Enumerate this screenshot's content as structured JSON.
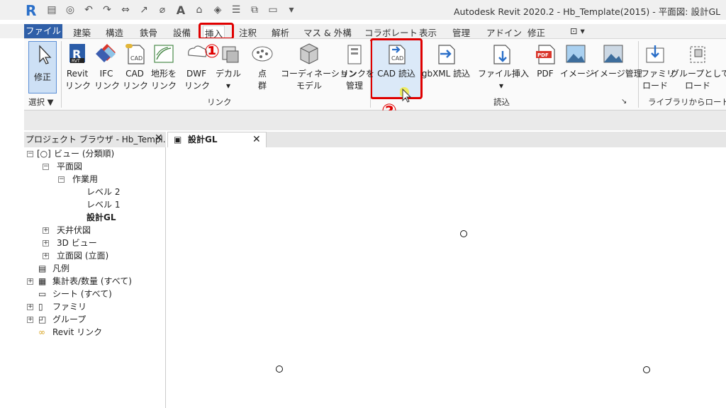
{
  "window": {
    "title": "Autodesk Revit 2020.2 - Hb_Template(2015) - 平面図: 設計GL",
    "logo": "R"
  },
  "ribbon_tabs": [
    "ファイル",
    "建築",
    "構造",
    "鉄骨",
    "設備",
    "挿入",
    "注釈",
    "解析",
    "マス & 外構",
    "コラボレート",
    "表示",
    "管理",
    "アドイン",
    "修正"
  ],
  "active_tab": "挿入",
  "ribbon": {
    "modify": {
      "line1": "修正"
    },
    "select_panel": "選択 ▼",
    "link_panel": "リンク",
    "import_panel": "読込",
    "library_panel": "ライブラリからロード",
    "buttons": {
      "revit_link": [
        "Revit",
        "リンク"
      ],
      "ifc_link": [
        "IFC",
        "リンク"
      ],
      "cad_link": [
        "CAD",
        "リンク"
      ],
      "topo_link": [
        "地形を",
        "リンク"
      ],
      "dwf_link": [
        "DWF",
        "リンク"
      ],
      "decal": [
        "デカル",
        ""
      ],
      "point_cloud": [
        "点",
        "群"
      ],
      "coordination_model": [
        "コーディネーション",
        "モデル"
      ],
      "manage_links": [
        "リンクを",
        "管理"
      ],
      "cad_import": [
        "CAD 読込",
        ""
      ],
      "gbxml_import": [
        "gbXML 読込",
        ""
      ],
      "file_insert": [
        "ファイル挿入",
        ""
      ],
      "pdf": [
        "PDF",
        ""
      ],
      "image": [
        "イメージ",
        ""
      ],
      "image_manage": [
        "イメージ管理",
        ""
      ],
      "family_load": [
        "ファミリ",
        "ロード"
      ],
      "group_load": [
        "グループとして",
        "ロード"
      ]
    },
    "step1": "①",
    "step2": "②"
  },
  "browser": {
    "header": "プロジェクト ブラウザ - Hb_Templ...",
    "items": {
      "views": "ビュー (分類順)",
      "floor_plans": "平面図",
      "working": "作業用",
      "level2": "レベル 2",
      "level1": "レベル 1",
      "design_gl": "設計GL",
      "ceiling": "天井伏図",
      "view3d": "3D ビュー",
      "elevations": "立面図 (立面)",
      "legends": "凡例",
      "schedules": "集計表/数量 (すべて)",
      "sheets": "シート (すべて)",
      "families": "ファミリ",
      "groups": "グループ",
      "revit_links": "Revit リンク"
    }
  },
  "view_tab": {
    "label": "設計GL"
  },
  "colors": {
    "accent": "#2f5fa8",
    "highlight": "#e00000"
  }
}
